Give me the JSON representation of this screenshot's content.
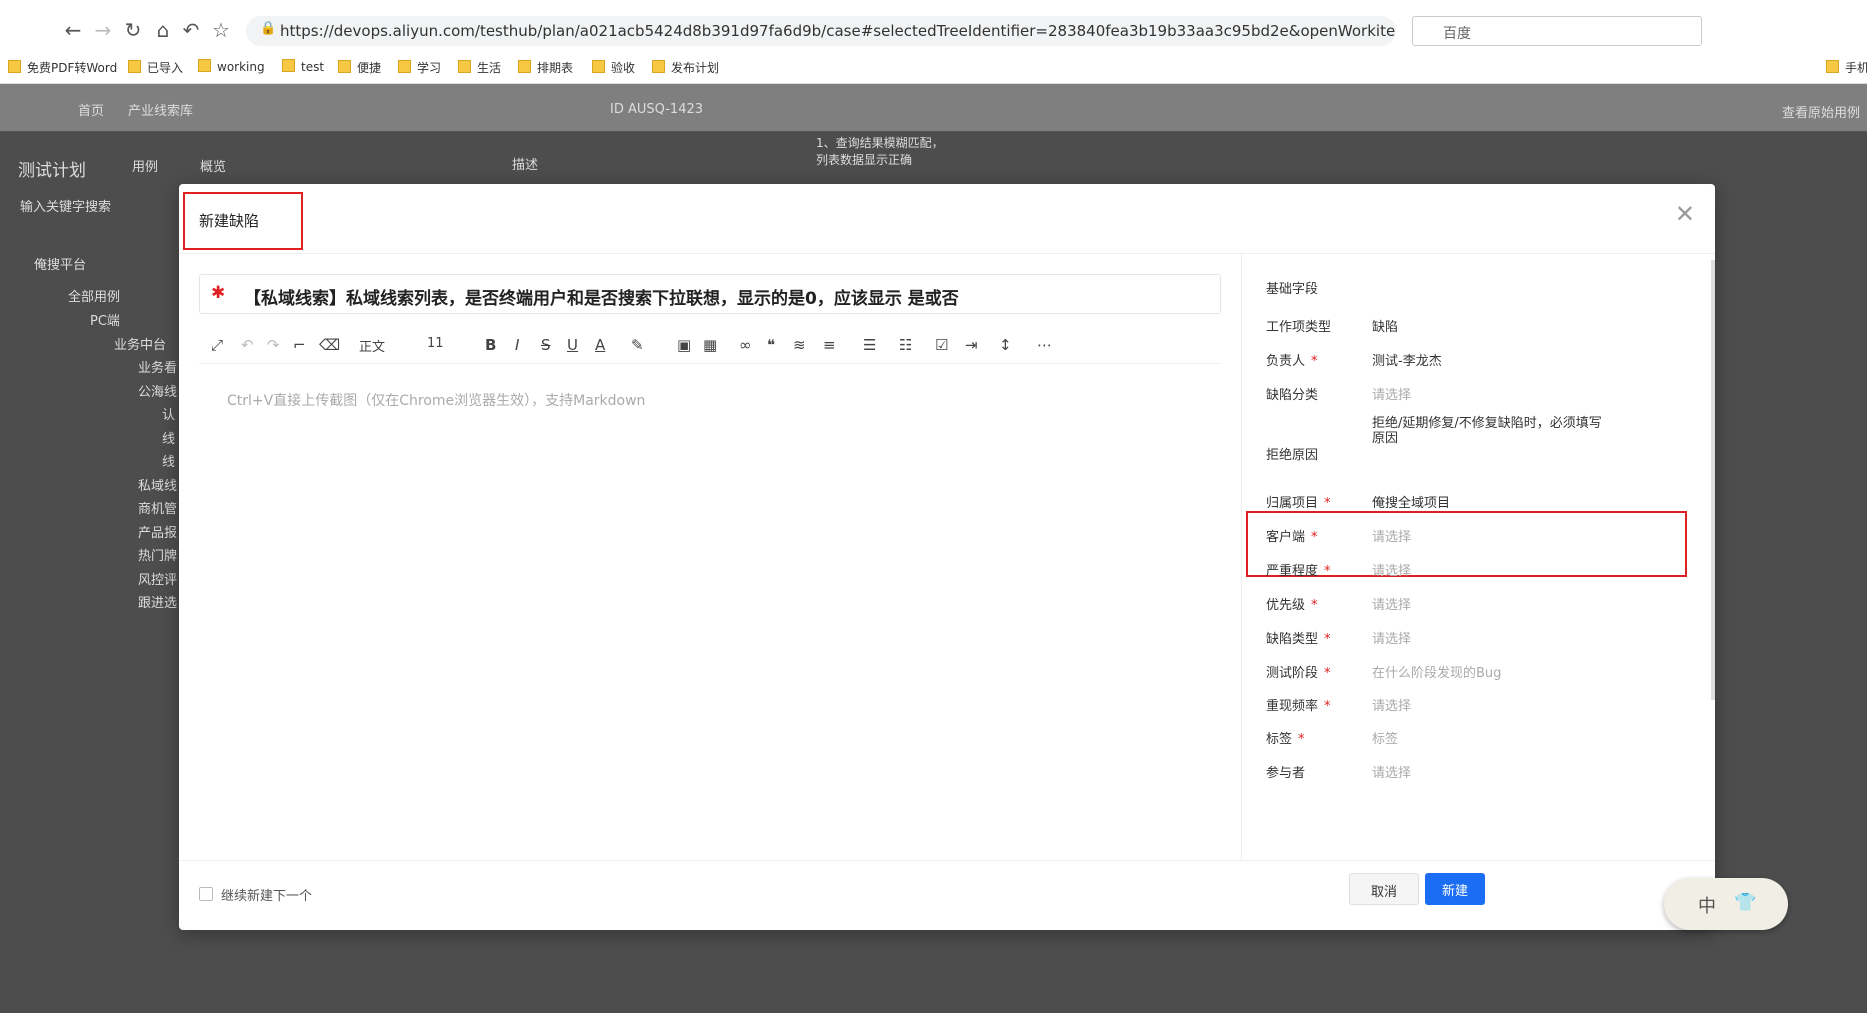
{
  "browser": {
    "url": "https://devops.aliyun.com/testhub/plan/a021acb5424d8b391d97fa6d9b/case#selectedTreeIdentifier=283840fea3b19b33aa3c95bd2e&openWorkite...",
    "search_engine": "百度",
    "bookmarks": [
      "免费PDF转Word",
      "已导入",
      "working",
      "test",
      "便捷",
      "学习",
      "生活",
      "排期表",
      "验收",
      "发布计划",
      "手机"
    ]
  },
  "app": {
    "breadcrumb_home": "首页",
    "breadcrumb_current": "产业线索库",
    "case_id": "ID AUSQ-1423",
    "view_original": "查看原始用例",
    "plan_title": "测试计划",
    "tabs": [
      "用例",
      "概览"
    ],
    "search_placeholder": "输入关键字搜索",
    "desc_tab": "描述",
    "desc_text": "1、查询结果模糊匹配，列表数据显示正确",
    "tree": [
      "俺搜平台",
      "全部用例",
      "PC端",
      "业务中台",
      "业务看",
      "公海线",
      "认",
      "线",
      "线",
      "私域线",
      "商机管",
      "产品报",
      "热门牌",
      "风控评",
      "跟进选"
    ]
  },
  "modal": {
    "title": "新建缺陷",
    "issue_title": "【私域线索】私域线索列表，是否终端用户和是否搜索下拉联想，显示的是0，应该显示 是或否",
    "toolbar": {
      "style": "正文",
      "size": "11"
    },
    "editor_placeholder": "Ctrl+V直接上传截图（仅在Chrome浏览器生效），支持Markdown",
    "basic_fields": "基础字段",
    "fields": [
      {
        "label": "工作项类型",
        "required": false,
        "value": "缺陷",
        "placeholder": false
      },
      {
        "label": "负责人",
        "required": true,
        "value": "测试-李龙杰",
        "placeholder": false
      },
      {
        "label": "缺陷分类",
        "required": false,
        "value": "请选择",
        "placeholder": true
      },
      {
        "label": "拒绝原因",
        "required": false,
        "value": "拒绝/延期修复/不修复缺陷时，必须填写原因",
        "placeholder": false
      },
      {
        "label": "归属项目",
        "required": true,
        "value": "俺搜全域项目",
        "placeholder": false
      },
      {
        "label": "客户端",
        "required": true,
        "value": "请选择",
        "placeholder": true
      },
      {
        "label": "严重程度",
        "required": true,
        "value": "请选择",
        "placeholder": true
      },
      {
        "label": "优先级",
        "required": true,
        "value": "请选择",
        "placeholder": true
      },
      {
        "label": "缺陷类型",
        "required": true,
        "value": "请选择",
        "placeholder": true
      },
      {
        "label": "测试阶段",
        "required": true,
        "value": "在什么阶段发现的Bug",
        "placeholder": true
      },
      {
        "label": "重现频率",
        "required": true,
        "value": "请选择",
        "placeholder": true
      },
      {
        "label": "标签",
        "required": true,
        "value": "标签",
        "placeholder": true
      },
      {
        "label": "参与者",
        "required": false,
        "value": "请选择",
        "placeholder": true
      }
    ],
    "continue_label": "继续新建下一个",
    "cancel": "取消",
    "create": "新建",
    "ime": "中"
  }
}
